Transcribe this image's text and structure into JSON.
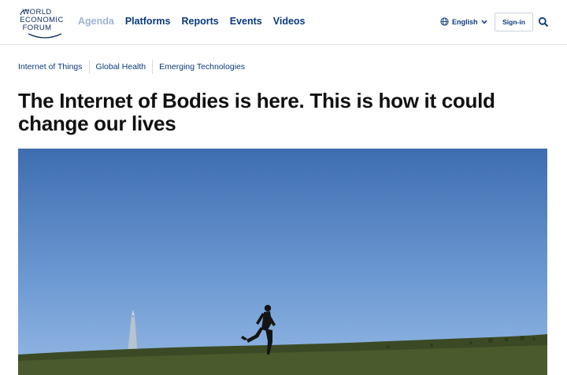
{
  "logo": {
    "lines": [
      "WORLD",
      "ECONOMIC",
      "FORUM"
    ]
  },
  "nav": {
    "items": [
      {
        "label": "Agenda",
        "state": "muted"
      },
      {
        "label": "Platforms"
      },
      {
        "label": "Reports"
      },
      {
        "label": "Events"
      },
      {
        "label": "Videos"
      }
    ]
  },
  "header": {
    "language": "English",
    "signin_label": "Sign-in"
  },
  "article": {
    "tags": [
      "Internet of Things",
      "Global Health",
      "Emerging Technologies"
    ],
    "title": "The Internet of Bodies is here. This is how it could change our lives"
  },
  "colors": {
    "brand": "#0a3a7c",
    "sky_top": "#3d6fb3",
    "sky_bottom": "#8ab2e0",
    "grass": "#3a4a25"
  }
}
